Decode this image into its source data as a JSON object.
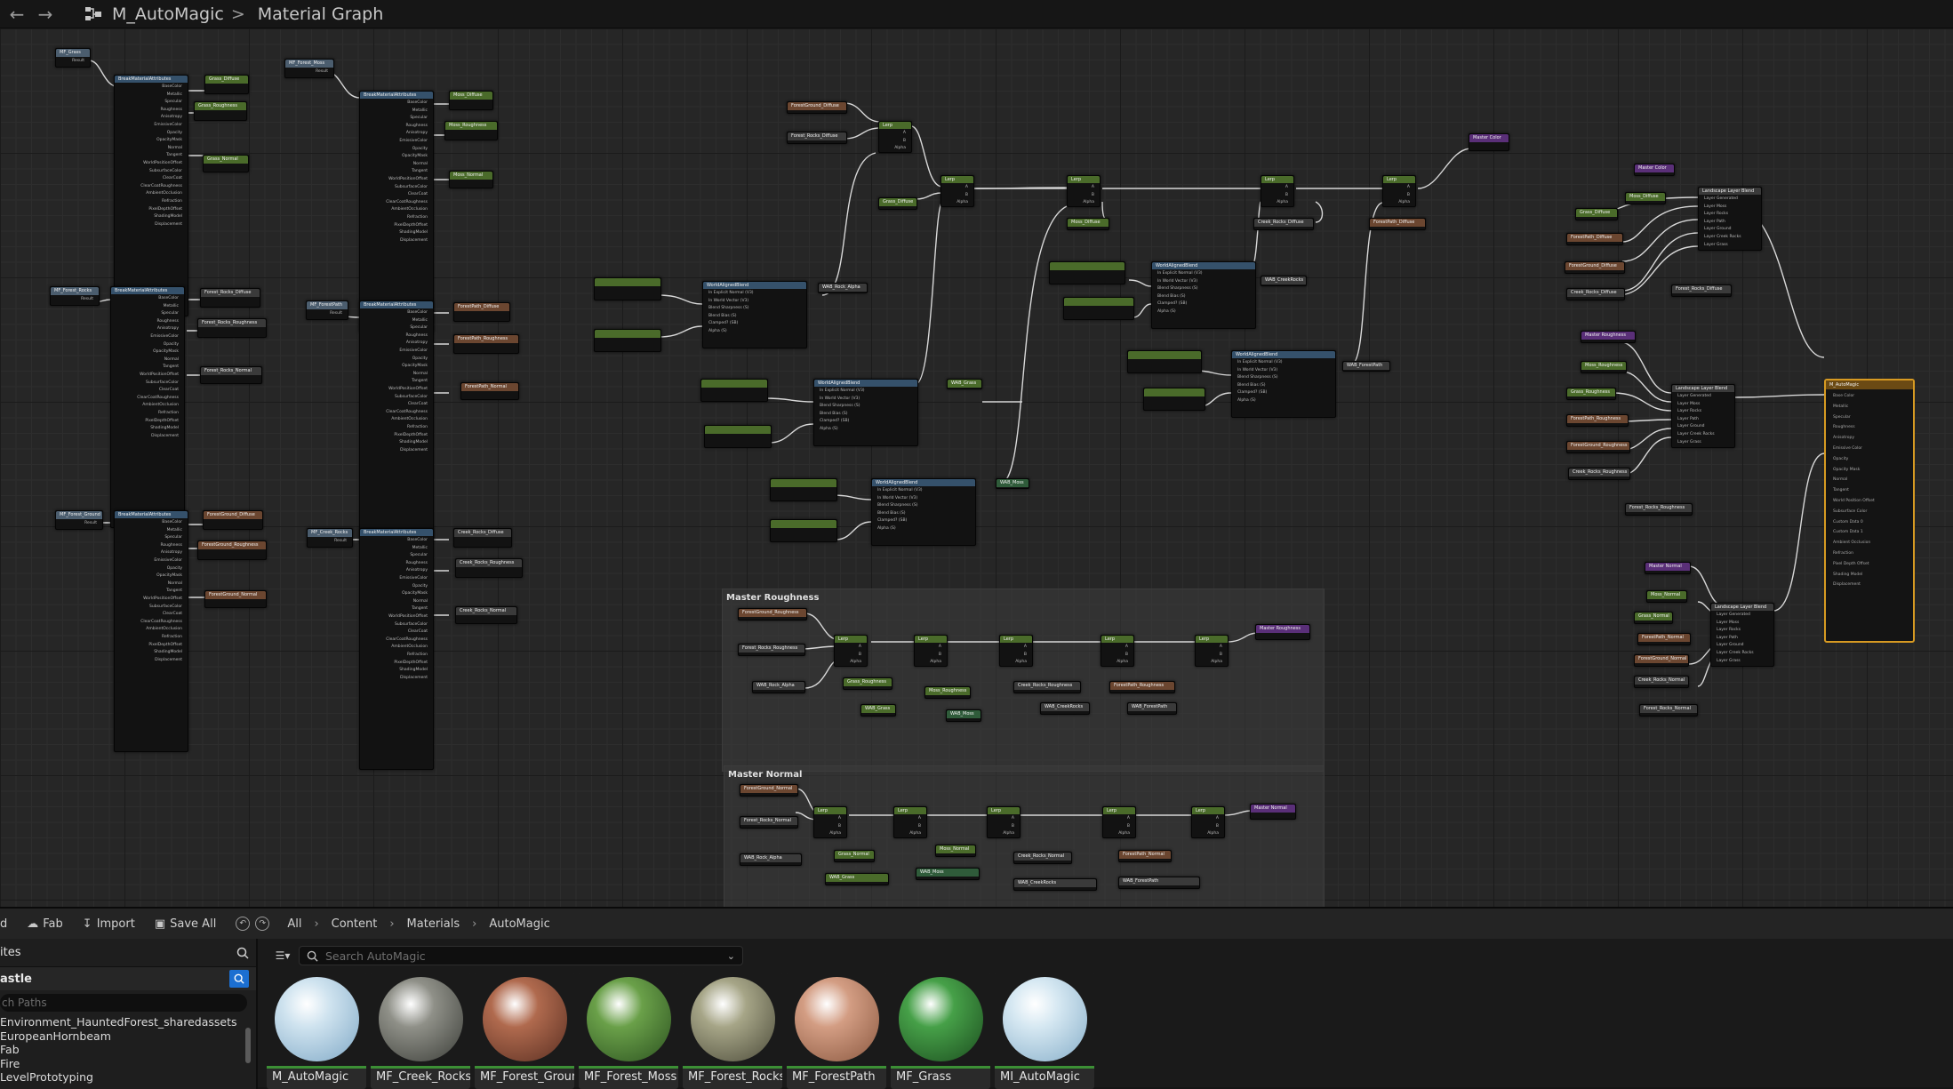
{
  "titlebar": {
    "back_icon": "arrow-left-icon",
    "forward_icon": "arrow-right-icon",
    "asset_name": "M_AutoMagic",
    "separator": ">",
    "graph_name": "Material Graph"
  },
  "graph": {
    "comments": [
      {
        "title": "Master Roughness"
      },
      {
        "title": "Master Normal"
      }
    ],
    "master_node": {
      "title": "M_AutoMagic",
      "pins": [
        "Base Color",
        "Metallic",
        "Specular",
        "Roughness",
        "Anisotropy",
        "Emissive Color",
        "Opacity",
        "Opacity Mask",
        "Normal",
        "Tangent",
        "World Position Offset",
        "Subsurface Color",
        "Custom Data 0",
        "Custom Data 1",
        "Ambient Occlusion",
        "Refraction",
        "Pixel Depth Offset",
        "Shading Model",
        "Displacement"
      ]
    },
    "nodes": [
      {
        "title": "MF_Grass",
        "pins": [
          "Result"
        ]
      },
      {
        "title": "BreakMaterialAttributes",
        "pins": [
          "Attr",
          "BaseColor",
          "Metallic",
          "Specular",
          "Roughness",
          "Anisotropy",
          "EmissiveColor",
          "Opacity",
          "OpacityMask",
          "Normal",
          "Tangent",
          "WorldPositionOffset",
          "SubsurfaceColor",
          "ClearCoat",
          "ClearCoatRoughness",
          "AmbientOcclusion",
          "Refraction",
          "PixelDepthOffset",
          "ShadingModel",
          "Displacement"
        ]
      },
      {
        "title": "Grass_Diffuse",
        "pins": []
      },
      {
        "title": "Grass_Roughness",
        "pins": []
      },
      {
        "title": "Grass_Normal",
        "pins": []
      },
      {
        "title": "MF_Forest_Moss",
        "pins": [
          "Result"
        ]
      },
      {
        "title": "Moss_Diffuse",
        "pins": []
      },
      {
        "title": "Moss_Roughness",
        "pins": []
      },
      {
        "title": "Moss_Normal",
        "pins": []
      },
      {
        "title": "MF_Forest_Rocks",
        "pins": [
          "Result"
        ]
      },
      {
        "title": "Forest_Rocks_Diffuse",
        "pins": []
      },
      {
        "title": "Forest_Rocks_Roughness",
        "pins": []
      },
      {
        "title": "Forest_Rocks_Normal",
        "pins": []
      },
      {
        "title": "MF_ForestPath",
        "pins": [
          "Result"
        ]
      },
      {
        "title": "ForestPath_Diffuse",
        "pins": []
      },
      {
        "title": "ForestPath_Roughness",
        "pins": []
      },
      {
        "title": "ForestPath_Normal",
        "pins": []
      },
      {
        "title": "MF_Forest_Ground",
        "pins": [
          "Result"
        ]
      },
      {
        "title": "ForestGround_Diffuse",
        "pins": []
      },
      {
        "title": "ForestGround_Roughness",
        "pins": []
      },
      {
        "title": "ForestGround_Normal",
        "pins": []
      },
      {
        "title": "MF_Creek_Rocks",
        "pins": [
          "Result"
        ]
      },
      {
        "title": "Creek_Rocks_Diffuse",
        "pins": []
      },
      {
        "title": "Creek_Rocks_Roughness",
        "pins": []
      },
      {
        "title": "Creek_Rocks_Normal",
        "pins": []
      },
      {
        "title": "Lerp",
        "pins": [
          "A",
          "B",
          "Alpha"
        ]
      },
      {
        "title": "WorldAlignedBlend",
        "pins": [
          "In Explicit Normal (V3)",
          "In World Vector (V3)",
          "Blend Sharpness (S)",
          "Blend Bias (S)",
          "Clamped? (SB)",
          "Alpha (S)"
        ]
      },
      {
        "title": "Master Color",
        "pins": []
      },
      {
        "title": "Master Roughness",
        "pins": []
      },
      {
        "title": "Master Normal",
        "pins": []
      },
      {
        "title": "Landscape Layer Blend",
        "pins": [
          "Layer Generated",
          "Layer Moss",
          "Layer Rocks",
          "Layer Path",
          "Layer Ground",
          "Layer Creek Rocks",
          "Layer Grass"
        ]
      },
      {
        "title": "WAB_Rock_Alpha",
        "pins": []
      },
      {
        "title": "WAB_Grass",
        "pins": []
      },
      {
        "title": "WAB_Moss",
        "pins": []
      },
      {
        "title": "WAB_CreekRocks",
        "pins": []
      },
      {
        "title": "WAB_ForestPath",
        "pins": []
      }
    ]
  },
  "toolbar": {
    "partial_label": "d",
    "fab_label": "Fab",
    "import_label": "Import",
    "save_all_label": "Save All",
    "history_back_icon": "history-back-icon",
    "history_forward_icon": "history-forward-icon",
    "path": [
      "All",
      "Content",
      "Materials",
      "AutoMagic"
    ]
  },
  "sources": {
    "header": "ites",
    "project": "astle",
    "path_placeholder": "ch Paths",
    "folders": [
      "Environment_HauntedForest_sharedassets",
      "EuropeanHornbeam",
      "Fab",
      "Fire",
      "LevelPrototyping"
    ]
  },
  "asset_search": {
    "placeholder": "Search AutoMagic"
  },
  "assets": [
    {
      "name": "M_AutoMagic",
      "sphere": "#cfe3ef",
      "sphere2": "#7fa8c6"
    },
    {
      "name": "MF_Creek_Rocks",
      "sphere": "#8f9088",
      "sphere2": "#3b3d38"
    },
    {
      "name": "MF_Forest_Ground",
      "sphere": "#b06a4e",
      "sphere2": "#5a2f22"
    },
    {
      "name": "MF_Forest_Moss",
      "sphere": "#6aa049",
      "sphere2": "#2c5220"
    },
    {
      "name": "MF_Forest_Rocks",
      "sphere": "#a6a587",
      "sphere2": "#4c4b3a"
    },
    {
      "name": "MF_ForestPath",
      "sphere": "#d39d83",
      "sphere2": "#8a5840"
    },
    {
      "name": "MF_Grass",
      "sphere": "#46a048",
      "sphere2": "#1c4d1f"
    },
    {
      "name": "MI_AutoMagic",
      "sphere": "#d6e8f2",
      "sphere2": "#86aec9"
    }
  ],
  "colors": {
    "accent_blue": "#1c6fd1",
    "master_border": "#d79a22",
    "asset_bar": "#3c8f35"
  }
}
